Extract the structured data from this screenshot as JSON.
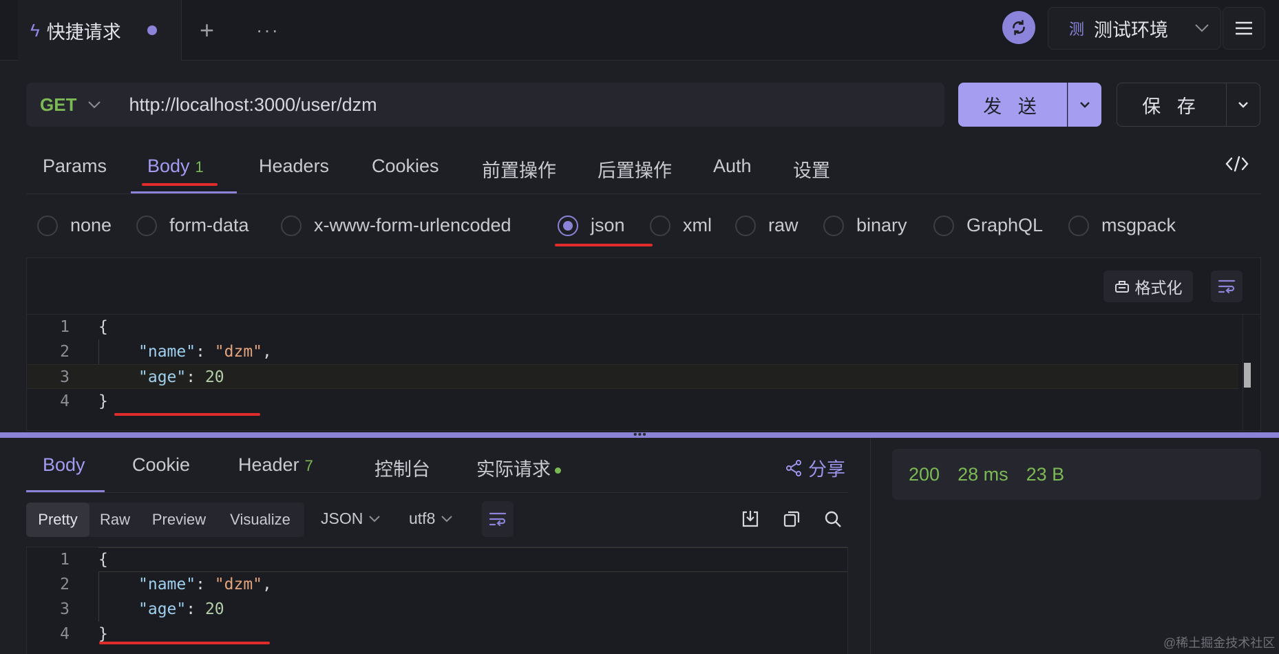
{
  "top_tabs": {
    "request_tab_label": "快捷请求",
    "add_label": "+",
    "more_label": "···"
  },
  "environment": {
    "badge": "测",
    "label": "测试环境"
  },
  "request": {
    "method": "GET",
    "url": "http://localhost:3000/user/dzm",
    "send_label": "发 送",
    "save_label": "保 存"
  },
  "request_tabs": [
    {
      "label": "Params"
    },
    {
      "label": "Body",
      "badge": "1"
    },
    {
      "label": "Headers"
    },
    {
      "label": "Cookies"
    },
    {
      "label": "前置操作"
    },
    {
      "label": "后置操作"
    },
    {
      "label": "Auth"
    },
    {
      "label": "设置"
    }
  ],
  "body_types": [
    "none",
    "form-data",
    "x-www-form-urlencoded",
    "json",
    "xml",
    "raw",
    "binary",
    "GraphQL",
    "msgpack"
  ],
  "selected_body_type": "json",
  "editor": {
    "format_label": "格式化",
    "lines": [
      {
        "num": "1",
        "text": "{"
      },
      {
        "num": "2",
        "key": "\"name\"",
        "value": "\"dzm\"",
        "trail": ","
      },
      {
        "num": "3",
        "key": "\"age\"",
        "value": "20",
        "trail": ""
      },
      {
        "num": "4",
        "text": "}"
      }
    ]
  },
  "response": {
    "tabs": [
      {
        "label": "Body"
      },
      {
        "label": "Cookie"
      },
      {
        "label": "Header",
        "badge": "7"
      },
      {
        "label": "控制台"
      },
      {
        "label": "实际请求"
      }
    ],
    "share_label": "分享",
    "view_modes": [
      "Pretty",
      "Raw",
      "Preview",
      "Visualize"
    ],
    "format": "JSON",
    "encoding": "utf8",
    "status": "200",
    "time": "28 ms",
    "size": "23 B",
    "lines": [
      {
        "num": "1",
        "text": "{"
      },
      {
        "num": "2",
        "key": "\"name\"",
        "value": "\"dzm\"",
        "trail": ","
      },
      {
        "num": "3",
        "key": "\"age\"",
        "value": "20",
        "trail": ""
      },
      {
        "num": "4",
        "text": "}"
      }
    ]
  },
  "watermark": "@稀土掘金技术社区",
  "colors": {
    "accent": "#8a83d8",
    "method_green": "#7cb955",
    "background": "#1e1f25",
    "annotation_red": "#e02b2b"
  }
}
